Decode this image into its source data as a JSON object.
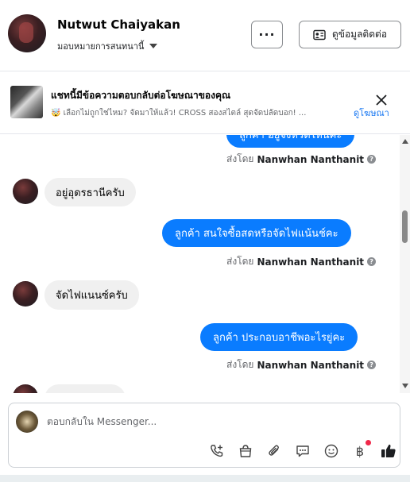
{
  "header": {
    "contact_name": "Nutwut Chaiyakan",
    "assignee_label": "มอบหมายการสนทนานี้",
    "more_label": "···",
    "contact_info_label": "ดูข้อมูลติดต่อ"
  },
  "ad_banner": {
    "title": "แชทนี้มีข้อความตอบกลับต่อโฆษณาของคุณ",
    "description": "🤯 เลือกไม่ถูกใช่ไหม? จัดมาให้แล้ว! CROSS สองสไตล์ สุดจัดปลัดบอก! ...",
    "view_ad_label": "ดูโฆษณา"
  },
  "messages": [
    {
      "direction": "out",
      "text": "ลูกค้า อยู่จังหวัดไหนคะ",
      "sent_by_prefix": "ส่งโดย",
      "sent_by_name": "Nanwhan Nanthanit"
    },
    {
      "direction": "in",
      "text": "อยู่อุดรธานีครับ"
    },
    {
      "direction": "out",
      "text": "ลูกค้า  สนใจซื้อสดหรือจัดไฟแน้นช์คะ",
      "sent_by_prefix": "ส่งโดย",
      "sent_by_name": "Nanwhan Nanthanit"
    },
    {
      "direction": "in",
      "text": "จัดไฟแนนซ์ครับ"
    },
    {
      "direction": "out",
      "text": "ลูกค้า  ประกอบอาชีพอะไรยู่คะ",
      "sent_by_prefix": "ส่งโดย",
      "sent_by_name": "Nanwhan Nanthanit"
    },
    {
      "direction": "in",
      "text": ""
    }
  ],
  "composer": {
    "placeholder": "ตอบกลับใน Messenger..."
  },
  "colors": {
    "outgoing_bubble": "#0a7cff",
    "incoming_bubble": "#f0f0f0",
    "link": "#1877f2",
    "like": "#1c1e21"
  },
  "icons": [
    "call-add-icon",
    "shopping-bag-icon",
    "attachment-icon",
    "saved-replies-icon",
    "emoji-icon",
    "baht-payment-icon",
    "like-icon"
  ]
}
